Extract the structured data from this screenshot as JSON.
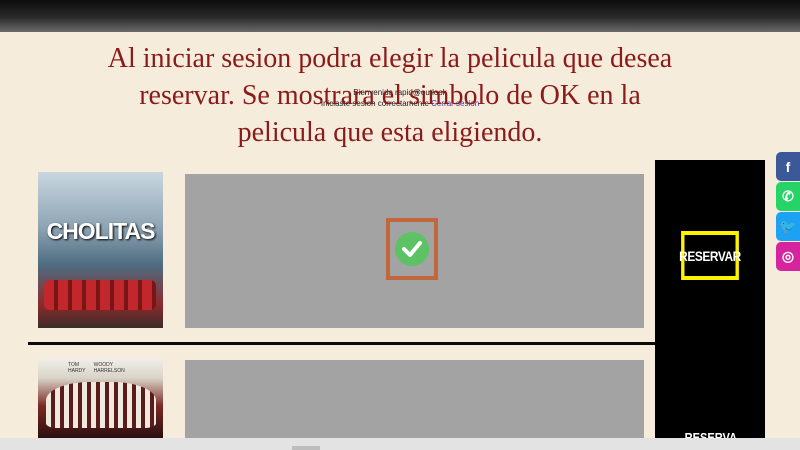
{
  "caption": {
    "line1": "Al iniciar sesion podra elegir la pelicula que desea",
    "line2": "reservar. Se mostrara el simbolo de OK en la",
    "line3": "pelicula que esta eligiendo."
  },
  "login": {
    "welcome": "Bienvenido rapid@outlook",
    "status": "Iniciaste sesion correctamente",
    "logout_label": "Cerrar sesion"
  },
  "movies": [
    {
      "poster_title": "CHOLITAS",
      "reserve_label": "RESERVAR",
      "selected": true
    },
    {
      "poster_credits": [
        "TOM HARDY",
        "WOODY HARRELSON"
      ],
      "reserve_label": "RESERVAR",
      "selected": false
    }
  ],
  "social": [
    {
      "icon": "facebook-icon",
      "glyph": "f",
      "color": "#3b5998"
    },
    {
      "icon": "whatsapp-icon",
      "glyph": "✆",
      "color": "#25d366"
    },
    {
      "icon": "twitter-icon",
      "glyph": "🐦",
      "color": "#1da1f2"
    },
    {
      "icon": "instagram-icon",
      "glyph": "◎",
      "color": "#d6249f"
    }
  ],
  "colors": {
    "background": "#f5ecdc",
    "caption": "#8b1a1a",
    "highlight_reserve": "#fff200",
    "highlight_check": "#c0673d",
    "check": "#5cc263"
  }
}
